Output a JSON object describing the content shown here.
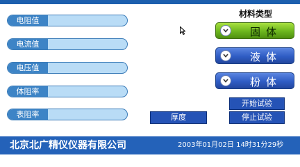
{
  "fields": [
    {
      "label": "电阻值",
      "value": ""
    },
    {
      "label": "电流值",
      "value": ""
    },
    {
      "label": "电压值",
      "value": ""
    },
    {
      "label": "体阻率",
      "value": ""
    },
    {
      "label": "表阻率",
      "value": ""
    }
  ],
  "material": {
    "title": "材料类型",
    "options": [
      {
        "label": "固体",
        "selected": true
      },
      {
        "label": "液体",
        "selected": false
      },
      {
        "label": "粉体",
        "selected": false
      }
    ]
  },
  "buttons": {
    "start": "开始试验",
    "stop": "停止试验",
    "thickness": "厚度"
  },
  "status": {
    "company": "北京北广精仪仪器有限公司",
    "datetime": "2003年01月02日 14时31分29秒"
  },
  "colors": {
    "accent": "#2462b9",
    "selected": "#6cb61e",
    "field_bg": "#b9dcf6"
  }
}
